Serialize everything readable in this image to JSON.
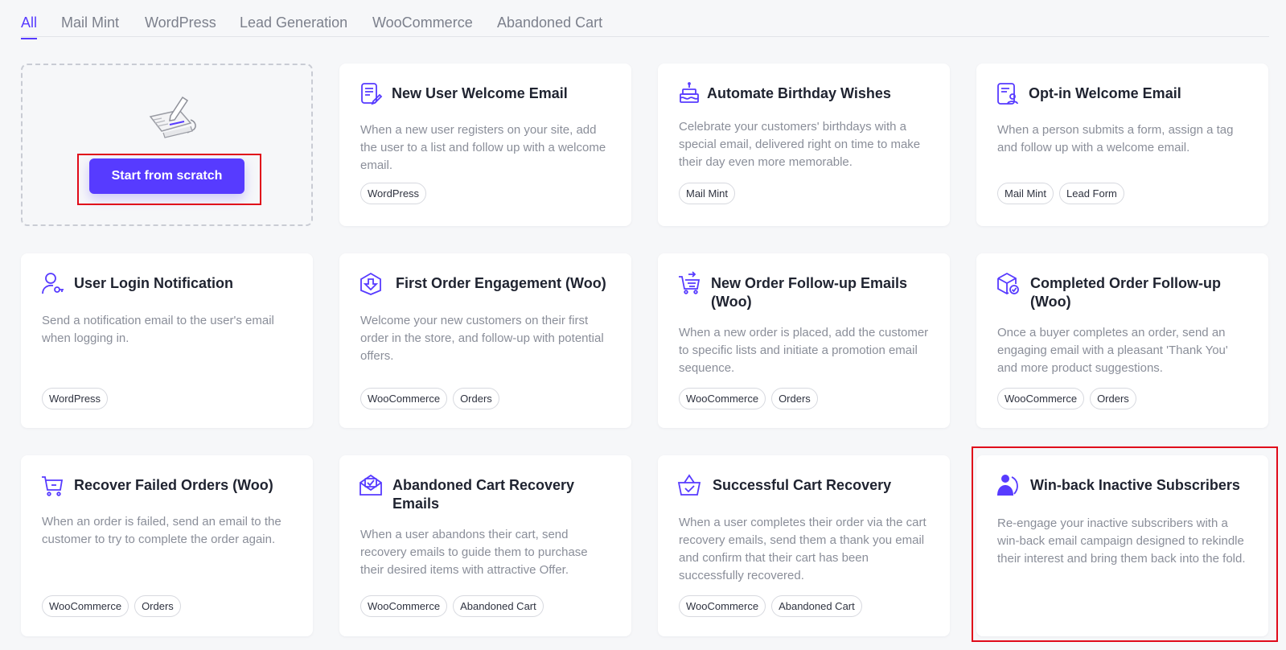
{
  "tabs": [
    "All",
    "Mail Mint",
    "WordPress",
    "Lead Generation",
    "WooCommerce",
    "Abandoned Cart"
  ],
  "scratch": {
    "button_label": "Start from scratch"
  },
  "cards": [
    {
      "title": "New User Welcome Email",
      "desc": "When a new user registers on your site, add the user to a list and follow up with a welcome email.",
      "tags": [
        "WordPress"
      ],
      "icon": "document-edit-icon"
    },
    {
      "title": "Automate Birthday Wishes",
      "desc": "Celebrate your customers' birthdays with a special email, delivered right on time to make their day even more memorable.",
      "tags": [
        "Mail Mint"
      ],
      "icon": "birthday-cake-icon"
    },
    {
      "title": "Opt-in Welcome Email",
      "desc": "When a person submits a form, assign a tag and follow up with a welcome email.",
      "tags": [
        "Mail Mint",
        "Lead Form"
      ],
      "icon": "form-user-icon"
    },
    {
      "title": "User Login Notification",
      "desc": "Send a notification email to the user's email when logging in.",
      "tags": [
        "WordPress"
      ],
      "icon": "user-key-icon"
    },
    {
      "title": "First Order Engagement (Woo)",
      "desc": "Welcome your new customers on their first order in the store, and follow-up with potential offers.",
      "tags": [
        "WooCommerce",
        "Orders"
      ],
      "icon": "box-download-icon"
    },
    {
      "title": "New Order Follow-up Emails (Woo)",
      "desc": "When a new order is placed, add the customer to specific lists and initiate a promotion email sequence.",
      "tags": [
        "WooCommerce",
        "Orders"
      ],
      "icon": "cart-arrow-icon"
    },
    {
      "title": "Completed Order Follow-up (Woo)",
      "desc": "Once a buyer completes an order, send an engaging email with a pleasant 'Thank You' and more product suggestions.",
      "tags": [
        "WooCommerce",
        "Orders"
      ],
      "icon": "box-check-icon"
    },
    {
      "title": "Recover Failed Orders (Woo)",
      "desc": "When an order is failed, send an email to the customer to try to complete the order again.",
      "tags": [
        "WooCommerce",
        "Orders"
      ],
      "icon": "cart-minus-icon"
    },
    {
      "title": "Abandoned Cart Recovery Emails",
      "desc": "When a user abandons their cart, send recovery emails to guide them to purchase their desired items with attractive Offer.",
      "tags": [
        "WooCommerce",
        "Abandoned Cart"
      ],
      "icon": "mail-check-icon"
    },
    {
      "title": "Successful Cart Recovery",
      "desc": "When a user completes their order via the cart recovery emails, send them a thank you email and confirm that their cart has been successfully recovered.",
      "tags": [
        "WooCommerce",
        "Abandoned Cart"
      ],
      "icon": "basket-check-icon"
    },
    {
      "title": "Win-back Inactive Subscribers",
      "desc": "Re-engage your inactive subscribers with a win-back email campaign designed to rekindle their interest and bring them back into the fold.",
      "tags": [],
      "icon": "user-return-icon"
    }
  ],
  "colors": {
    "accent": "#573bff",
    "highlight": "#e00a1a"
  }
}
